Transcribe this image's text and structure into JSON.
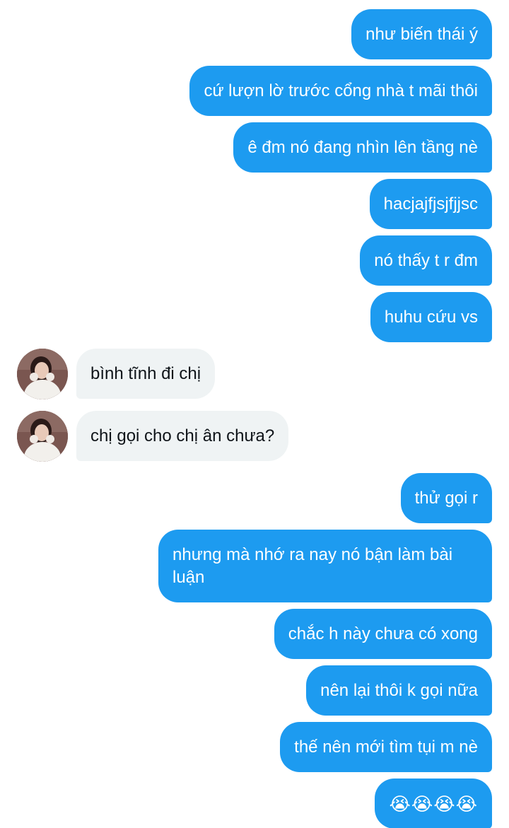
{
  "conversation": {
    "messages": [
      {
        "side": "sent",
        "text": "như biến thái ý"
      },
      {
        "side": "sent",
        "text": "cứ lượn lờ trước cổng nhà t mãi thôi"
      },
      {
        "side": "sent",
        "text": "ê đm nó đang nhìn lên tầng nè"
      },
      {
        "side": "sent",
        "text": "hacjajfjsjfjjsc"
      },
      {
        "side": "sent",
        "text": "nó thấy t r đm"
      },
      {
        "side": "sent",
        "text": "huhu cứu vs"
      },
      {
        "side": "received",
        "text": "bình tĩnh đi chị"
      },
      {
        "side": "received",
        "text": "chị gọi cho chị ân chưa?"
      },
      {
        "side": "sent",
        "text": "thử gọi r"
      },
      {
        "side": "sent",
        "text": "nhưng mà nhớ ra nay nó bận làm bài luận"
      },
      {
        "side": "sent",
        "text": "chắc h này chưa có xong"
      },
      {
        "side": "sent",
        "text": "nên lại thôi k gọi nữa"
      },
      {
        "side": "sent",
        "text": "thế nên mới tìm tụi m nè"
      },
      {
        "side": "sent",
        "text": "😭😭😭😭"
      }
    ]
  },
  "colors": {
    "sent_bubble": "#1d9bf0",
    "received_bubble": "#eff3f4",
    "sent_text": "#ffffff",
    "received_text": "#0f1419"
  },
  "icons": {
    "avatar": "contact-avatar-photo"
  }
}
